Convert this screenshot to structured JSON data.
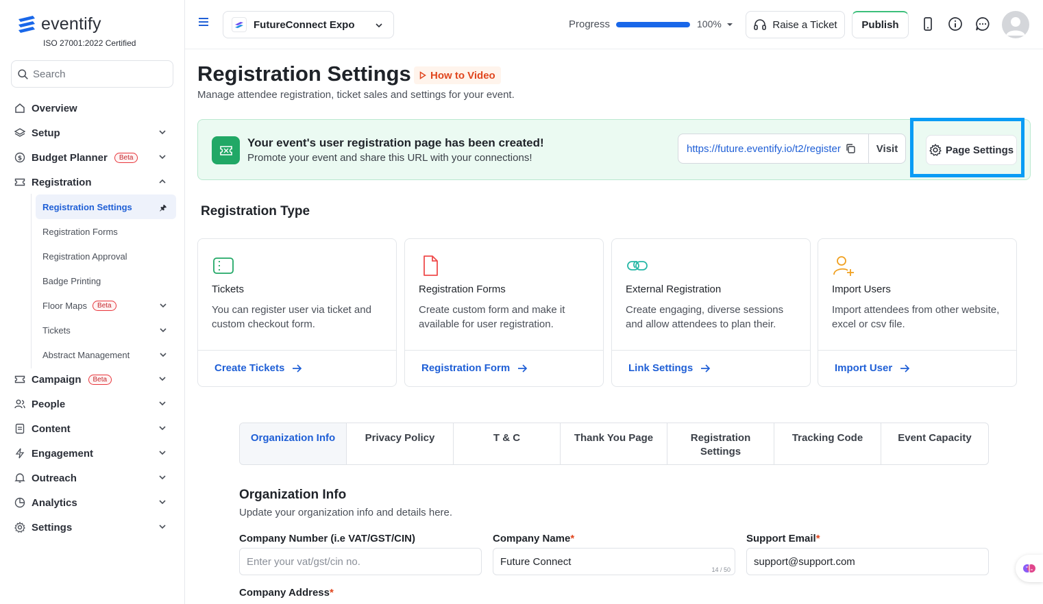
{
  "brand": {
    "name": "eventify",
    "certification": "ISO 27001:2022 Certified"
  },
  "search": {
    "placeholder": "Search"
  },
  "sidebar": {
    "items": [
      {
        "label": "Overview",
        "icon": "home-icon"
      },
      {
        "label": "Setup",
        "icon": "layers-icon"
      },
      {
        "label": "Budget Planner",
        "icon": "dollar-circle-icon",
        "badge": "Beta"
      },
      {
        "label": "Registration",
        "icon": "ticket-icon"
      },
      {
        "label": "Campaign",
        "icon": "ticket-icon",
        "badge": "Beta"
      },
      {
        "label": "People",
        "icon": "people-icon"
      },
      {
        "label": "Content",
        "icon": "document-icon"
      },
      {
        "label": "Engagement",
        "icon": "lightning-icon"
      },
      {
        "label": "Outreach",
        "icon": "bell-icon"
      },
      {
        "label": "Analytics",
        "icon": "pie-chart-icon"
      },
      {
        "label": "Settings",
        "icon": "gear-icon"
      }
    ],
    "registration_sub": [
      {
        "label": "Registration Settings"
      },
      {
        "label": "Registration Forms"
      },
      {
        "label": "Registration Approval"
      },
      {
        "label": "Badge Printing"
      },
      {
        "label": "Floor Maps",
        "badge": "Beta"
      },
      {
        "label": "Tickets"
      },
      {
        "label": "Abstract Management"
      }
    ]
  },
  "topbar": {
    "event_name": "FutureConnect Expo",
    "progress_label": "Progress",
    "progress_value": 100,
    "progress_text": "100%",
    "raise_ticket": "Raise a Ticket",
    "publish": "Publish"
  },
  "page": {
    "title": "Registration Settings",
    "how_to": "How to Video",
    "subtitle": "Manage attendee registration, ticket sales and settings for your event."
  },
  "banner": {
    "title": "Your event's user registration page has been created!",
    "subtitle": "Promote your event and share this URL with your connections!",
    "url": "https://future.eventify.io/t2/register",
    "visit": "Visit",
    "page_settings": "Page Settings"
  },
  "registration_type": {
    "title": "Registration Type",
    "cards": [
      {
        "title": "Tickets",
        "desc": "You can register user via ticket and custom checkout form.",
        "link": "Create Tickets",
        "icon": "ticket-icon",
        "color": "#21a866"
      },
      {
        "title": "Registration Forms",
        "desc": "Create custom form and make it available for user registration.",
        "link": "Registration Form",
        "icon": "document-icon",
        "color": "#ef4b4b"
      },
      {
        "title": "External Registration",
        "desc": "Create engaging, diverse sessions and allow attendees to plan their.",
        "link": "Link Settings",
        "icon": "link-icon",
        "color": "#26b7a6"
      },
      {
        "title": "Import Users",
        "desc": "Import attendees from other website, excel or csv file.",
        "link": "Import User",
        "icon": "user-add-icon",
        "color": "#f0a020"
      }
    ]
  },
  "tabs": [
    {
      "label": "Organization Info"
    },
    {
      "label": "Privacy Policy"
    },
    {
      "label": "T & C"
    },
    {
      "label": "Thank You Page"
    },
    {
      "label": "Registration Settings"
    },
    {
      "label": "Tracking Code"
    },
    {
      "label": "Event Capacity"
    }
  ],
  "org": {
    "title": "Organization Info",
    "subtitle": "Update your organization info and details here.",
    "company_number_label": "Company Number (i.e VAT/GST/CIN)",
    "company_number_placeholder": "Enter your vat/gst/cin no.",
    "company_name_label": "Company Name",
    "company_name_value": "Future Connect",
    "company_name_counter": "14 / 50",
    "support_email_label": "Support Email",
    "support_email_value": "support@support.com",
    "company_address_label": "Company Address",
    "required_mark": "*"
  },
  "colors": {
    "accent": "#1f5fd6",
    "highlight": "#0a9cf5",
    "success": "#21a866"
  }
}
